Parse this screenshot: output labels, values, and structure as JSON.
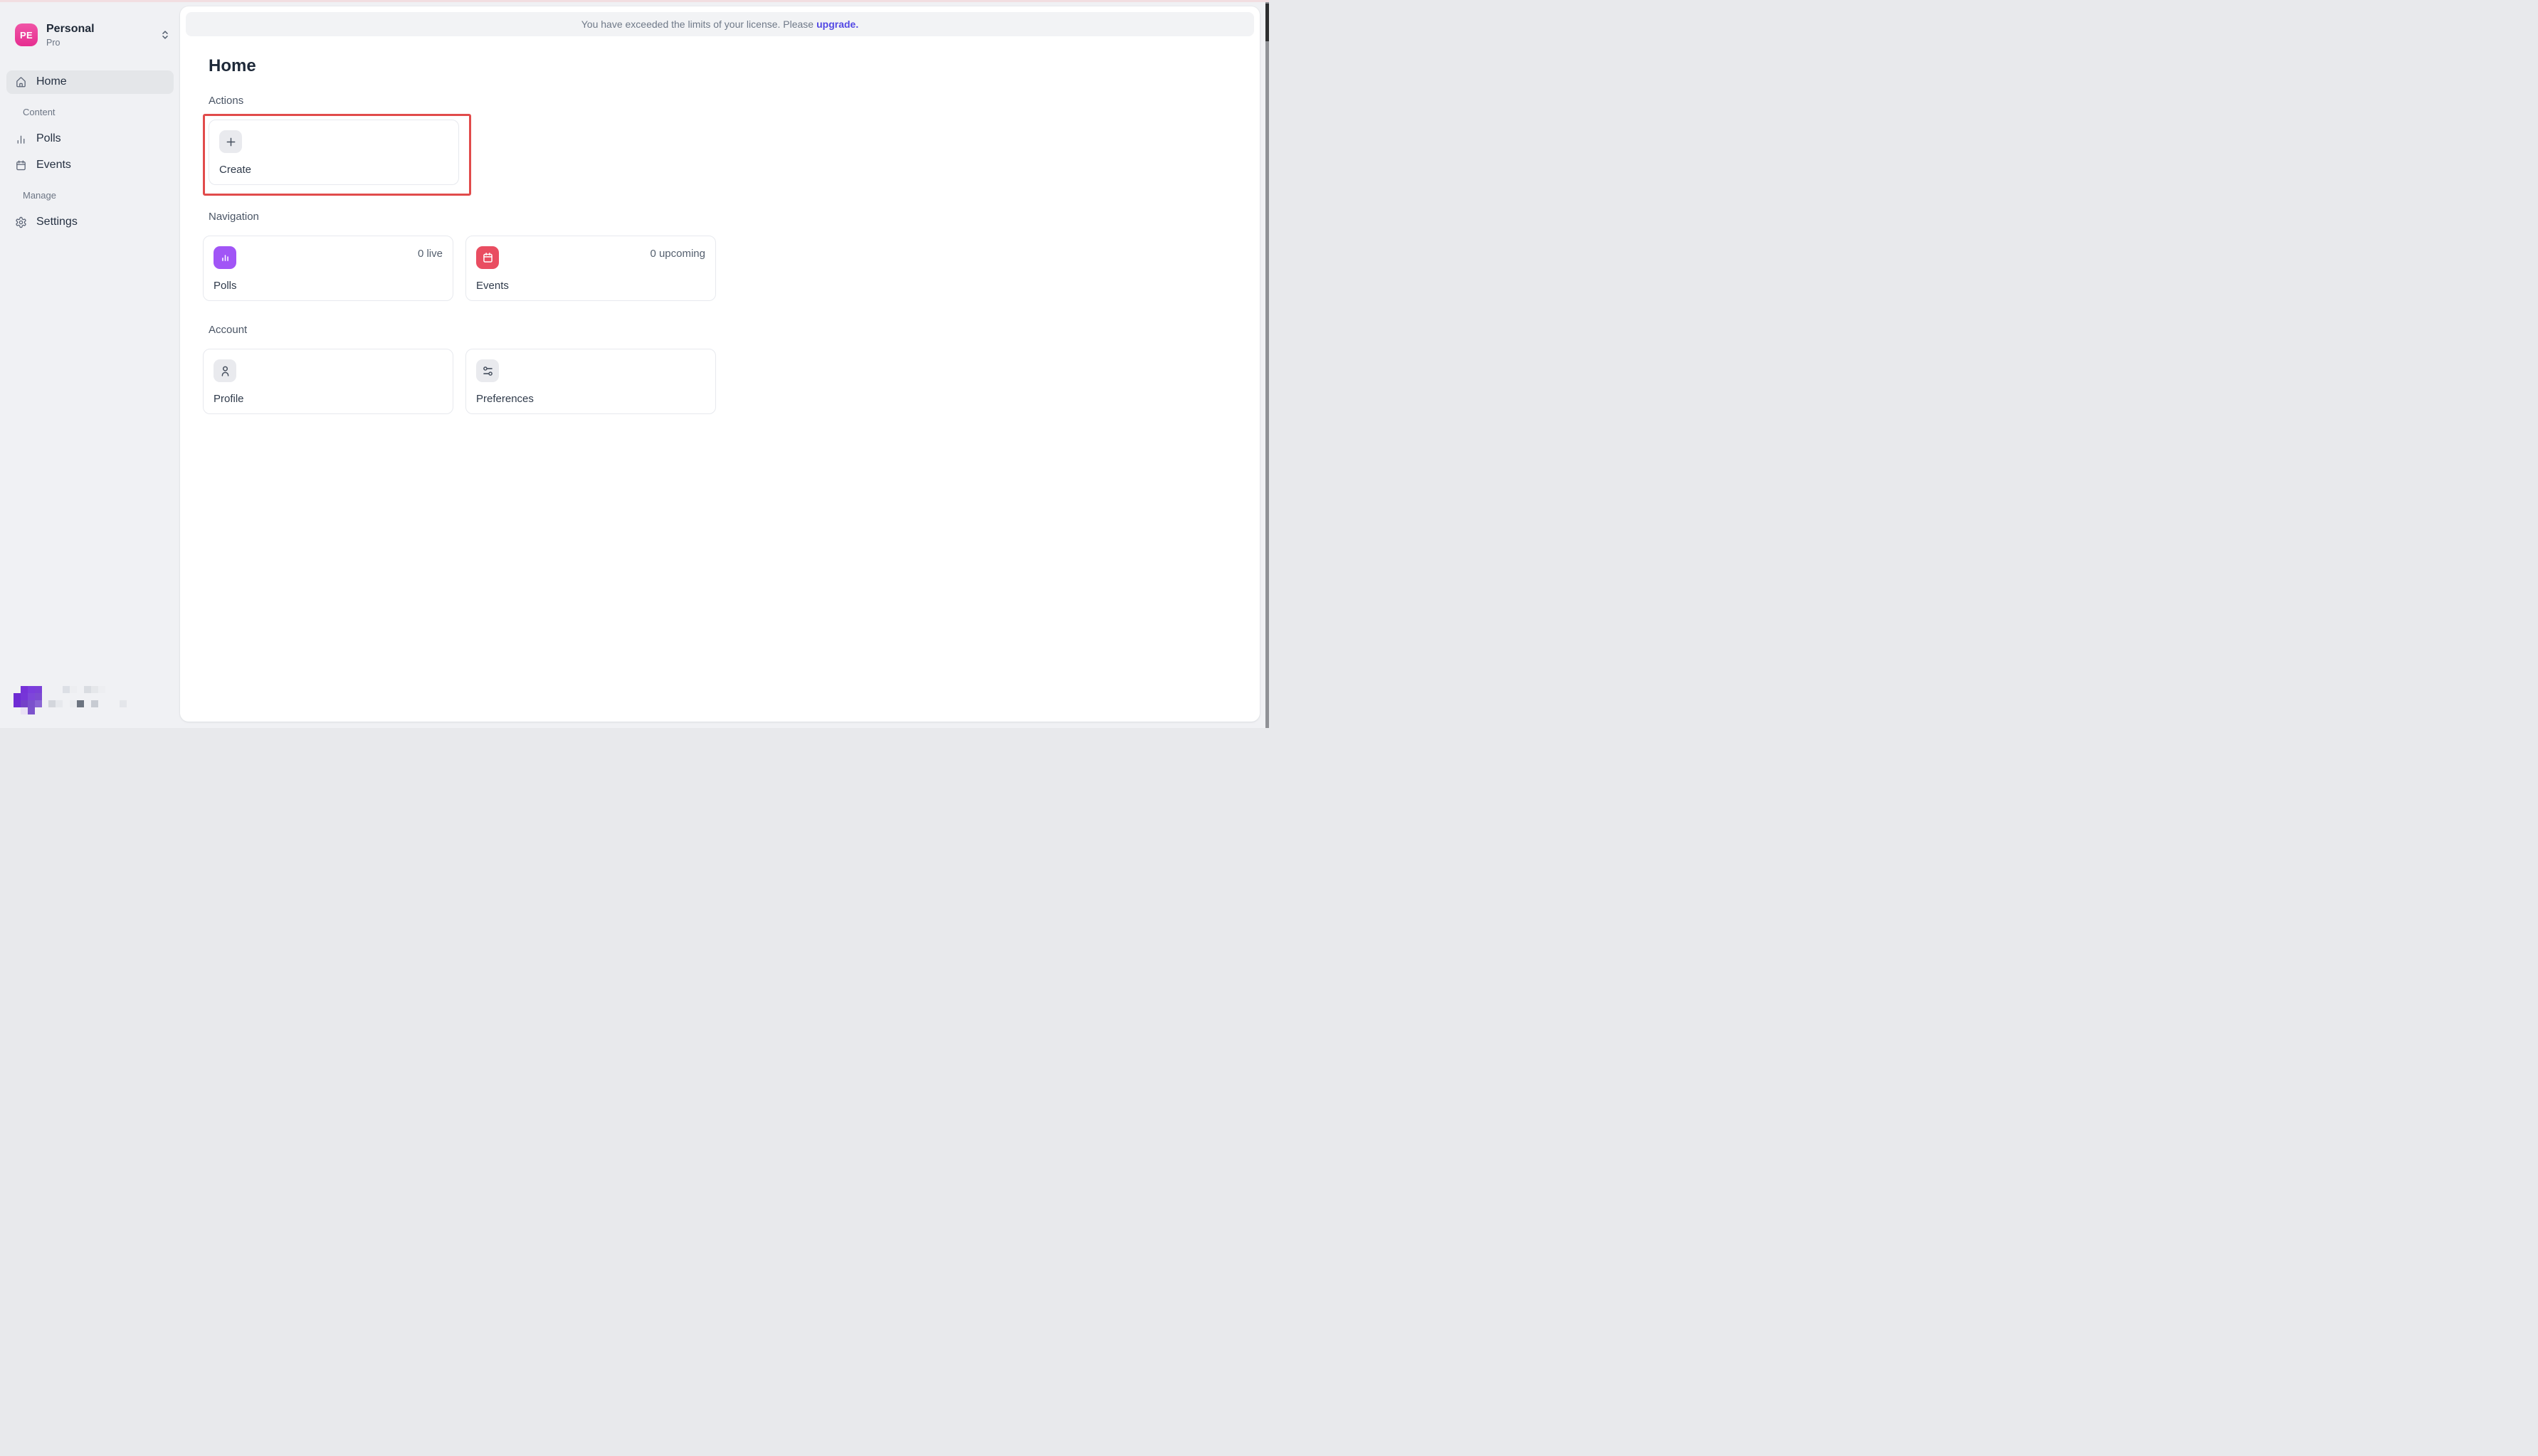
{
  "colors": {
    "workspace_avatar": "#e62e90",
    "active_nav_pill": "#e4e6e9",
    "banner_link": "#5348e4",
    "polls_tile": "#a155f6",
    "events_tile": "#e94d61",
    "annotation_border": "#e14b4b",
    "top_edge_strip": "#f2dee1"
  },
  "sidebar": {
    "workspace": {
      "initials": "PE",
      "name": "Personal",
      "plan": "Pro"
    },
    "home": {
      "label": "Home"
    },
    "groups": [
      {
        "label": "Content",
        "items": [
          {
            "label": "Polls"
          },
          {
            "label": "Events"
          }
        ]
      },
      {
        "label": "Manage",
        "items": [
          {
            "label": "Settings"
          }
        ]
      }
    ]
  },
  "banner": {
    "prefix": "You have exceeded the limits of your license. Please",
    "link": "upgrade",
    "suffix": "."
  },
  "page": {
    "title": "Home"
  },
  "main": {
    "actions": {
      "label": "Actions",
      "create": {
        "label": "Create"
      }
    },
    "navigation": {
      "label": "Navigation",
      "polls": {
        "label": "Polls",
        "count": "0 live"
      },
      "events": {
        "label": "Events",
        "count": "0 upcoming"
      }
    },
    "account": {
      "label": "Account",
      "profile": {
        "label": "Profile"
      },
      "preferences": {
        "label": "Preferences"
      }
    }
  },
  "logo_mosaic": {
    "cell_size": 10,
    "cells": [
      [
        12,
        9,
        "#7632d8"
      ],
      [
        22,
        9,
        "#7b3ddd"
      ],
      [
        32,
        9,
        "#7b40d8"
      ],
      [
        2,
        19,
        "#6d2bd3"
      ],
      [
        12,
        19,
        "#7635d8"
      ],
      [
        22,
        19,
        "#7e46da"
      ],
      [
        32,
        19,
        "#7d4bd2"
      ],
      [
        2,
        29,
        "#6e2cd4"
      ],
      [
        12,
        29,
        "#7441c8"
      ],
      [
        22,
        29,
        "#7b51cc"
      ],
      [
        32,
        29,
        "#8a65d4"
      ],
      [
        12,
        39,
        "#e9e1f5"
      ],
      [
        22,
        39,
        "#7c53cc"
      ],
      [
        71,
        9,
        "#dcdfe5"
      ],
      [
        81,
        9,
        "#edeef1"
      ],
      [
        101,
        9,
        "#d9dce1"
      ],
      [
        111,
        9,
        "#e5e7ea"
      ],
      [
        121,
        9,
        "#edeef1"
      ],
      [
        51,
        29,
        "#d3d6dc"
      ],
      [
        61,
        29,
        "#e6e8ec"
      ],
      [
        81,
        29,
        "#eaecef"
      ],
      [
        91,
        29,
        "#6c7480"
      ],
      [
        111,
        29,
        "#c7cbd2"
      ],
      [
        151,
        29,
        "#e4e6ea"
      ]
    ]
  }
}
